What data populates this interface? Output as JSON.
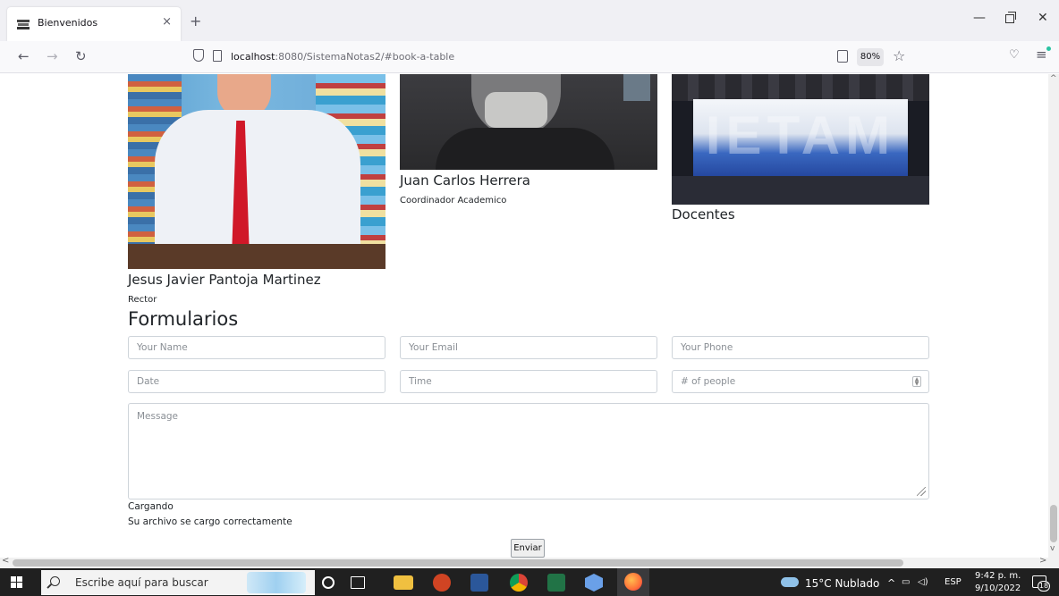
{
  "browser": {
    "tab_title": "Bienvenidos",
    "tab_close": "×",
    "new_tab": "+",
    "url_host": "localhost",
    "url_rest": ":8080/SistemaNotas2/#book-a-table",
    "zoom": "80%"
  },
  "staff": [
    {
      "name": "Jesus Javier Pantoja Martinez",
      "role": "Rector"
    },
    {
      "name": "Juan Carlos Herrera",
      "role": "Coordinador Academico"
    },
    {
      "name": "Docentes",
      "role": ""
    }
  ],
  "photo_sign_text": "IETAM",
  "form": {
    "title": "Formularios",
    "name_placeholder": "Your Name",
    "email_placeholder": "Your Email",
    "phone_placeholder": "Your Phone",
    "date_placeholder": "Date",
    "time_placeholder": "Time",
    "people_placeholder": "# of people",
    "message_placeholder": "Message",
    "loading_text": "Cargando",
    "success_text": "Su archivo se cargo correctamente",
    "submit_label": "Enviar"
  },
  "taskbar": {
    "search_placeholder": "Escribe aquí para buscar",
    "weather": "15°C  Nublado",
    "language": "ESP",
    "time": "9:42 p. m.",
    "date": "9/10/2022",
    "notifications": "18"
  },
  "colors": {
    "title_bar": "#f0f0f4",
    "taskbar": "#202020",
    "input_border": "#ced4da"
  }
}
